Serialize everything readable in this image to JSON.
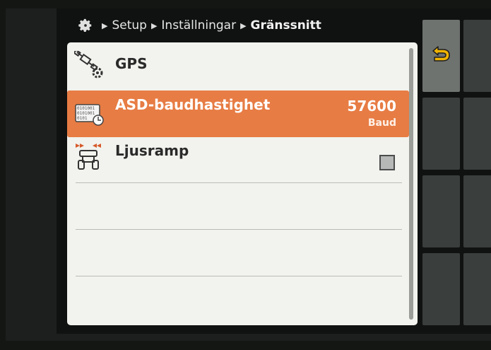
{
  "breadcrumb": {
    "items": [
      "Setup",
      "Inställningar",
      "Gränssnitt"
    ]
  },
  "menu": {
    "items": [
      {
        "label": "GPS",
        "icon": "gps-satellite-gear-icon"
      },
      {
        "label": "ASD-baudhastighet",
        "value": "57600",
        "unit": "Baud",
        "icon": "asd-baud-rate-icon",
        "selected": true
      },
      {
        "label": "Ljusramp",
        "icon": "light-ramp-icon",
        "checked": false
      }
    ]
  },
  "softkeys": {
    "back_icon": "return-arrow-icon"
  },
  "colors": {
    "selected_row": "#e77c44",
    "panel": "#f2f3ee",
    "return_arrow": "#f0b400"
  }
}
